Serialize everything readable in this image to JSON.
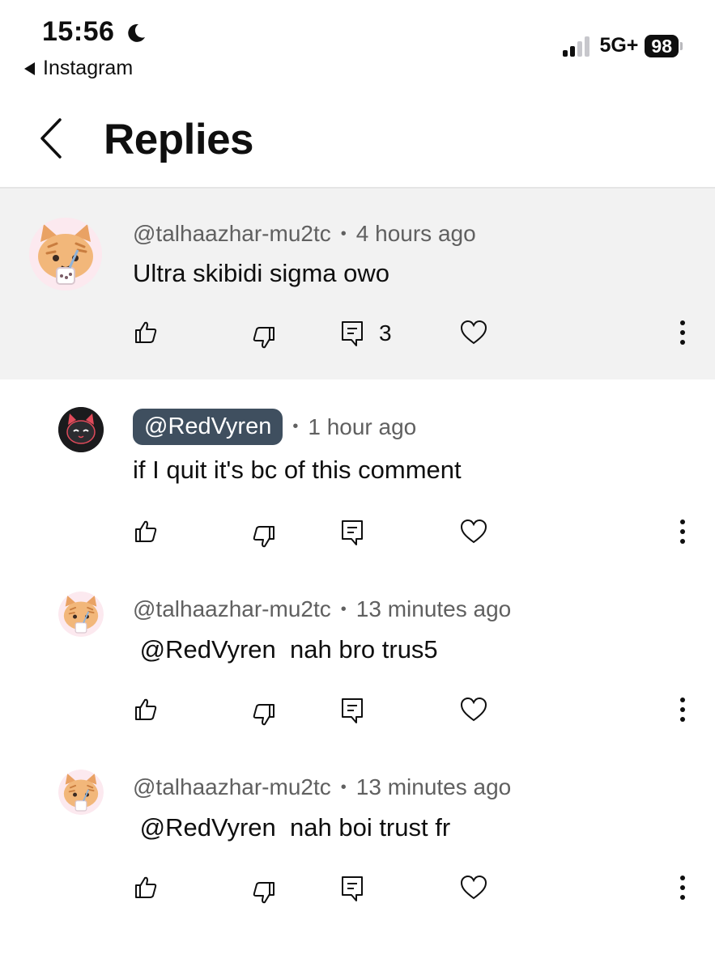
{
  "status_bar": {
    "time": "15:56",
    "back_app": "Instagram",
    "network": "5G+",
    "battery": "98"
  },
  "header": {
    "title": "Replies"
  },
  "comments": [
    {
      "handle": "@talhaazhar-mu2tc",
      "time": "4 hours ago",
      "text": "Ultra skibidi sigma owo",
      "reply_count": "3"
    },
    {
      "handle": "@RedVyren",
      "time": "1 hour ago",
      "text": "if I quit it's bc of this comment"
    },
    {
      "handle": "@talhaazhar-mu2tc",
      "time": "13 minutes ago",
      "text": " @RedVyren  nah bro trus5"
    },
    {
      "handle": "@talhaazhar-mu2tc",
      "time": "13 minutes ago",
      "text": " @RedVyren  nah boi trust fr"
    }
  ],
  "icons": {
    "like": "thumbs-up-icon",
    "dislike": "thumbs-down-icon",
    "reply": "comment-icon",
    "heart": "heart-icon",
    "more": "more-vertical-icon"
  }
}
